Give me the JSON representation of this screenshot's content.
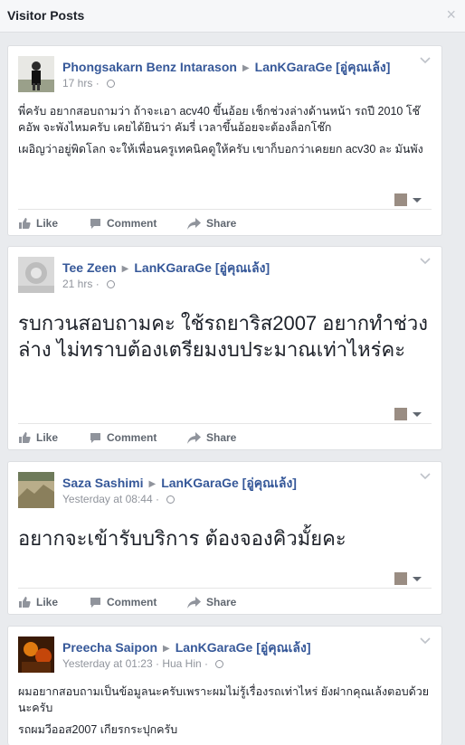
{
  "header": {
    "title": "Visitor Posts",
    "close_glyph": "×"
  },
  "actions": {
    "like": "Like",
    "comment": "Comment",
    "share": "Share"
  },
  "posts": [
    {
      "author": "Phongsakarn Benz Intarason",
      "page": "LanKGaraGe [อู่คุณเล้ง]",
      "time": "17 hrs",
      "paragraphs": [
        "พี่ครับ อยากสอบถามว่า ถ้าจะเอา acv40 ขึ้นอ้อย เช็กช่วงล่างด้านหน้า รถปี 2010 โช๊คอัพ จะพังไหมครับ เคยได้ยินว่า คัมรี่ เวลาขึ้นอ้อยจะต้องล็อกโช๊ก",
        "เผอิญว่าอยู่พิดโลก จะให้เพื่อนครูเทคนิคดูให้ครับ เขาก็บอกว่าเคยยก acv30 ละ มันพัง"
      ]
    },
    {
      "author": "Tee Zeen",
      "page": "LanKGaraGe [อู่คุณเล้ง]",
      "time": "21 hrs",
      "big_text": "รบกวนสอบถามคะ ใช้รถยาริส2007 อยากทำช่วงล่าง ไม่ทราบต้องเตรียมงบประมาณเท่าไหร่คะ"
    },
    {
      "author": "Saza Sashimi",
      "page": "LanKGaraGe [อู่คุณเล้ง]",
      "time": "Yesterday at 08:44",
      "big_text": "อยากจะเข้ารับบริการ ต้องจองคิวมั้ยคะ"
    },
    {
      "author": "Preecha Saipon",
      "page": "LanKGaraGe [อู่คุณเล้ง]",
      "time": "Yesterday at 01:23",
      "location": "Hua Hin",
      "paragraphs": [
        "ผมอยากสอบถามเป็นข้อมูลนะครับเพราะผมไม่รู้เรื่องรถเท่าไหร่ ยังฝากคุณเล้งตอบด้วยนะครับ",
        "รถผมวีออส2007 เกียรกระปุกครับ"
      ]
    }
  ]
}
